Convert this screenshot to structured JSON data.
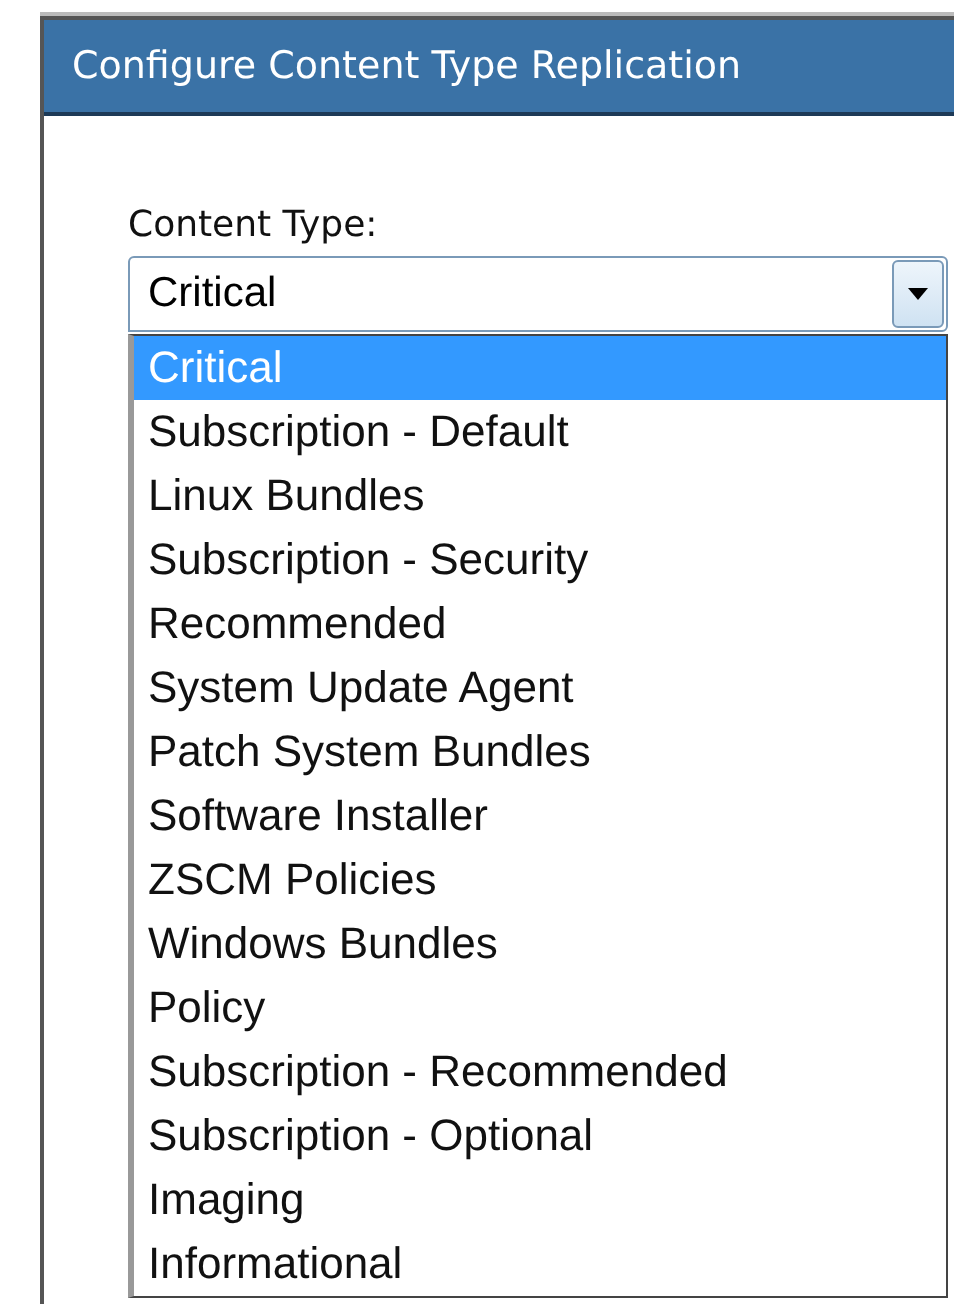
{
  "window": {
    "title": "Configure Content Type Replication"
  },
  "content_type": {
    "label": "Content Type:",
    "value": "Critical",
    "expanded": true,
    "options": [
      {
        "label": "Critical",
        "selected": true
      },
      {
        "label": "Subscription - Default",
        "selected": false
      },
      {
        "label": "Linux Bundles",
        "selected": false
      },
      {
        "label": "Subscription - Security",
        "selected": false
      },
      {
        "label": "Recommended",
        "selected": false
      },
      {
        "label": "System Update Agent",
        "selected": false
      },
      {
        "label": "Patch System Bundles",
        "selected": false
      },
      {
        "label": "Software Installer",
        "selected": false
      },
      {
        "label": "ZSCM Policies",
        "selected": false
      },
      {
        "label": "Windows Bundles",
        "selected": false
      },
      {
        "label": "Policy",
        "selected": false
      },
      {
        "label": "Subscription - Recommended",
        "selected": false
      },
      {
        "label": "Subscription - Optional",
        "selected": false
      },
      {
        "label": "Imaging",
        "selected": false
      },
      {
        "label": "Informational",
        "selected": false
      }
    ]
  }
}
